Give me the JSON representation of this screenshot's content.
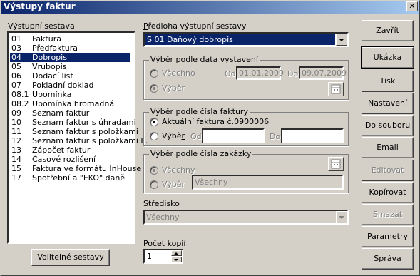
{
  "window": {
    "title": "Výstupy faktur",
    "close_label": "✕"
  },
  "left": {
    "list_title": "Výstupní sestava",
    "items": [
      {
        "code": "01",
        "name": "Faktura"
      },
      {
        "code": "03",
        "name": "Předfaktura"
      },
      {
        "code": "04",
        "name": "Dobropis"
      },
      {
        "code": "05",
        "name": "Vrubopis"
      },
      {
        "code": "06",
        "name": "Dodací list"
      },
      {
        "code": "07",
        "name": "Pokladní doklad"
      },
      {
        "code": "08.1",
        "name": "Upomínka"
      },
      {
        "code": "08.2",
        "name": "Upomínka hromadná"
      },
      {
        "code": "09",
        "name": "Seznam faktur"
      },
      {
        "code": "10",
        "name": "Seznam faktur s úhradami"
      },
      {
        "code": "11",
        "name": "Seznam faktur s položkami"
      },
      {
        "code": "12",
        "name": "Seznam faktur s položkami II."
      },
      {
        "code": "13",
        "name": "Zápočet faktur"
      },
      {
        "code": "14",
        "name": "Časové rozlišení"
      },
      {
        "code": "15",
        "name": "Faktura ve formátu InHouse"
      },
      {
        "code": "17",
        "name": "Spotřební a \"EKO\" daně"
      }
    ],
    "selected_code": "04",
    "optional_button": "Volitelné sestavy"
  },
  "form": {
    "template_label": "Předloha výstupní sestavy",
    "template_value": "S 01 Daňový dobropis",
    "date_group": {
      "caption": "Výběr podle data vystavení",
      "all": "Všechno",
      "selection": "Výběr",
      "from_label": "Od",
      "from_value": "01.01.2009",
      "to_label": "Do",
      "to_value": "09.07.2009"
    },
    "invoice_group": {
      "caption": "Výběr podle čísla faktury",
      "current": "Aktuální faktura č.0900006",
      "selection": "Výběr",
      "from_label": "Od",
      "from_value": "",
      "to_label": "Do",
      "to_value": ""
    },
    "order_group": {
      "caption": "Výběr podle čísla zakázky",
      "all": "Všechny",
      "selection": "Výběr",
      "selection_value": "Všechny"
    },
    "center_label": "Středisko",
    "center_value": "Všechny",
    "copies_label": "Počet kopií",
    "copies_value": "1"
  },
  "buttons": {
    "close": "Zavřít",
    "show": "Ukázka",
    "print": "Tisk",
    "settings": "Nastavení",
    "to_file": "Do souboru",
    "email": "Email",
    "edit": "Editovat",
    "copy": "Kopírovat",
    "delete": "Smazat",
    "parameters": "Parametry",
    "management": "Správa"
  }
}
